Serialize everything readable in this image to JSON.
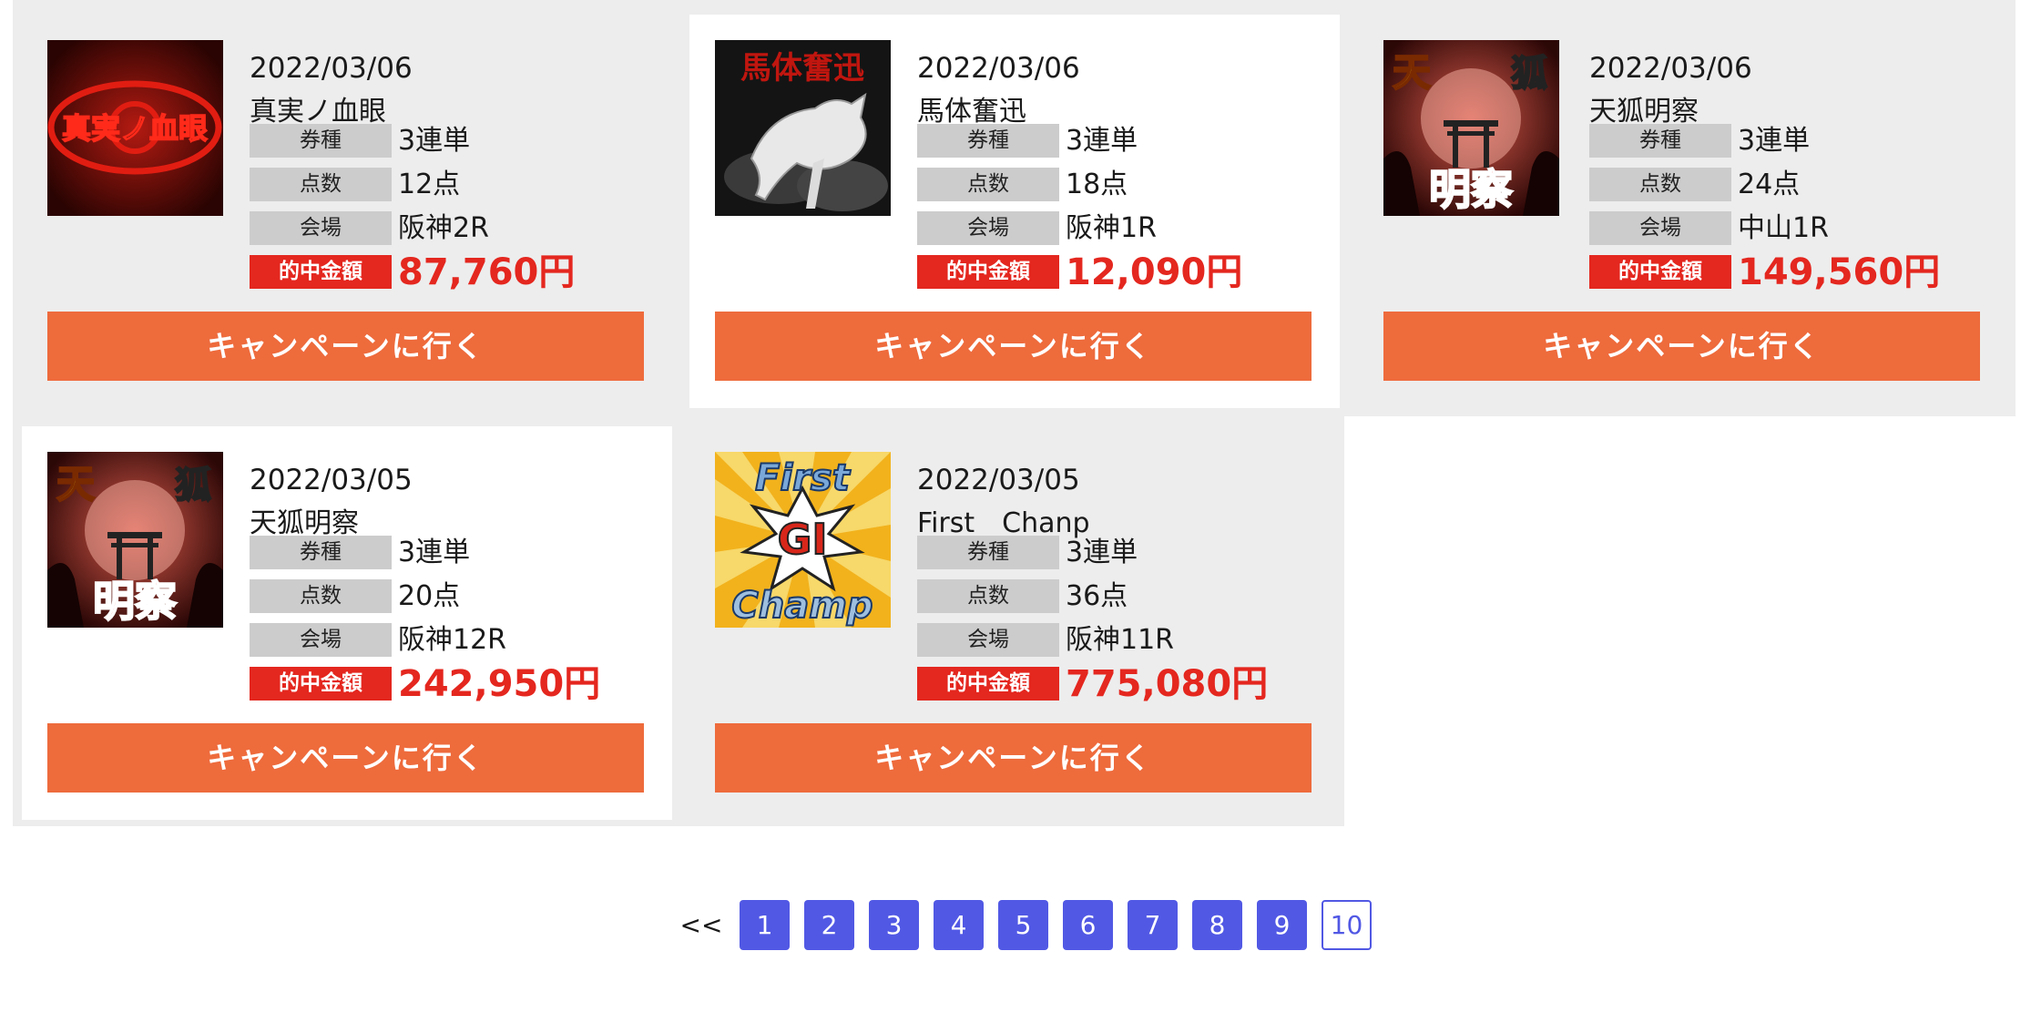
{
  "cards": [
    {
      "date": "2022/03/06",
      "name": "真実ノ血眼",
      "labels": {
        "type": "券種",
        "count": "点数",
        "venue": "会場",
        "win": "的中金額"
      },
      "type": "3連単",
      "count": "12点",
      "venue": "阪神2R",
      "win": "87,760円",
      "button": "キャンペーンに行く",
      "thumb": {
        "icon": "red-eye-logo",
        "text": "真実ノ血眼"
      }
    },
    {
      "date": "2022/03/06",
      "name": "馬体奮迅",
      "labels": {
        "type": "券種",
        "count": "点数",
        "venue": "会場",
        "win": "的中金額"
      },
      "type": "3連単",
      "count": "18点",
      "venue": "阪神1R",
      "win": "12,090円",
      "button": "キャンペーンに行く",
      "thumb": {
        "icon": "white-horse-logo",
        "text": "馬体奮迅"
      }
    },
    {
      "date": "2022/03/06",
      "name": "天狐明察",
      "labels": {
        "type": "券種",
        "count": "点数",
        "venue": "会場",
        "win": "的中金額"
      },
      "type": "3連単",
      "count": "24点",
      "venue": "中山1R",
      "win": "149,560円",
      "button": "キャンペーンに行く",
      "thumb": {
        "icon": "fox-torii-logo",
        "text_top_left": "天",
        "text_top_right": "狐",
        "text_bottom": "明察"
      }
    },
    {
      "date": "2022/03/05",
      "name": "天狐明察",
      "labels": {
        "type": "券種",
        "count": "点数",
        "venue": "会場",
        "win": "的中金額"
      },
      "type": "3連単",
      "count": "20点",
      "venue": "阪神12R",
      "win": "242,950円",
      "button": "キャンペーンに行く",
      "thumb": {
        "icon": "fox-torii-logo",
        "text_top_left": "天",
        "text_top_right": "狐",
        "text_bottom": "明察"
      }
    },
    {
      "date": "2022/03/05",
      "name": "First　Chanp",
      "labels": {
        "type": "券種",
        "count": "点数",
        "venue": "会場",
        "win": "的中金額"
      },
      "type": "3連単",
      "count": "36点",
      "venue": "阪神11R",
      "win": "775,080円",
      "button": "キャンペーンに行く",
      "thumb": {
        "icon": "first-champ-logo",
        "text_top": "First",
        "text_mid": "GI",
        "text_bottom": "Champ"
      }
    }
  ],
  "pagination": {
    "prev": "<<",
    "pages": [
      "1",
      "2",
      "3",
      "4",
      "5",
      "6",
      "7",
      "8",
      "9",
      "10"
    ],
    "current": "10"
  },
  "colors": {
    "grey_bg": "#ededed",
    "cta": "#ee6b3c",
    "win_red": "#e4271f",
    "label_grey": "#cccccc",
    "pager_blue": "#5158e4"
  }
}
